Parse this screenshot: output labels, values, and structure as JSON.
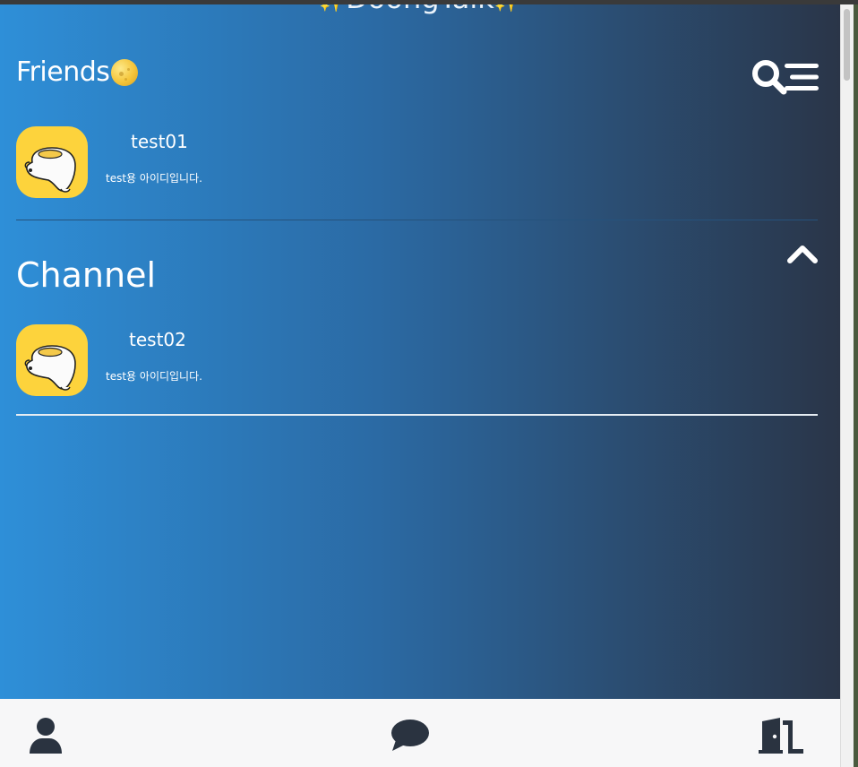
{
  "app": {
    "title": "DoongTalk",
    "title_sparkle": "✨",
    "accent_gradient": [
      "#2e8fd8",
      "#2a3548"
    ]
  },
  "header": {
    "title": "Friends",
    "title_icon": "moon-icon",
    "search_icon": "search-icon",
    "menu_icon": "menu-icon"
  },
  "friends": [
    {
      "name": "test01",
      "status": "test용 아이디입니다.",
      "avatar": "duck-avatar"
    }
  ],
  "channel": {
    "title": "Channel",
    "collapse_icon": "chevron-up-icon",
    "items": [
      {
        "name": "test02",
        "status": "test용 아이디입니다.",
        "avatar": "duck-avatar"
      }
    ]
  },
  "bottom_nav": [
    {
      "id": "friends",
      "icon": "user-icon"
    },
    {
      "id": "chats",
      "icon": "chat-bubble-icon"
    },
    {
      "id": "logout",
      "icon": "door-exit-icon"
    }
  ]
}
